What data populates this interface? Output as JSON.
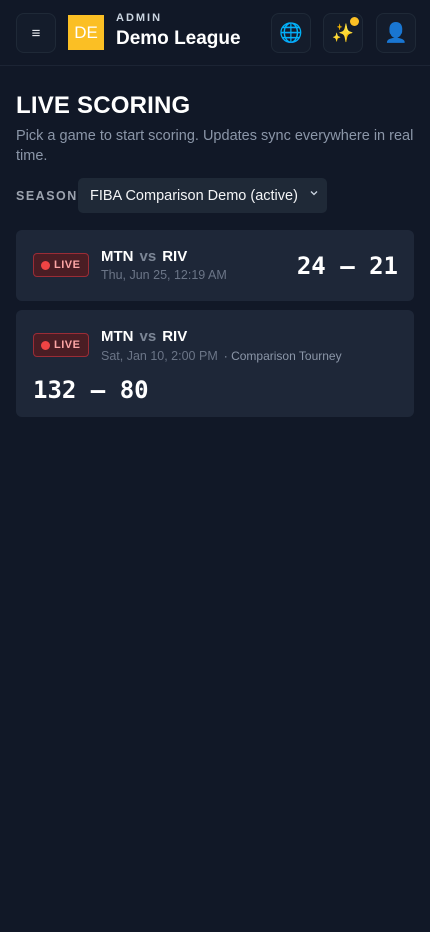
{
  "header": {
    "menu_icon": "≡",
    "logo_text": "DE",
    "admin_label": "ADMIN",
    "league_name": "Demo League",
    "globe_icon": "🌐",
    "sparkle_icon": "✨",
    "user_icon": "👤",
    "notification_color": "#fbbf24"
  },
  "page": {
    "title": "LIVE SCORING",
    "description": "Pick a game to start scoring. Updates sync everywhere in real time."
  },
  "season": {
    "label": "SEASON",
    "selected": "FIBA Comparison Demo (active)"
  },
  "games": [
    {
      "status": "LIVE",
      "home": "MTN",
      "vs": "vs",
      "away": "RIV",
      "datetime": "Thu, Jun 25, 12:19 AM",
      "tournament": "",
      "score": "24 – 21"
    },
    {
      "status": "LIVE",
      "home": "MTN",
      "vs": "vs",
      "away": "RIV",
      "datetime": "Sat, Jan 10, 2:00 PM",
      "tournament": "· Comparison Tourney",
      "score": "132 – 80"
    }
  ],
  "colors": {
    "background": "#111827",
    "card": "#1e2738",
    "live_red": "#ef4444",
    "accent_yellow": "#fbbf24"
  }
}
